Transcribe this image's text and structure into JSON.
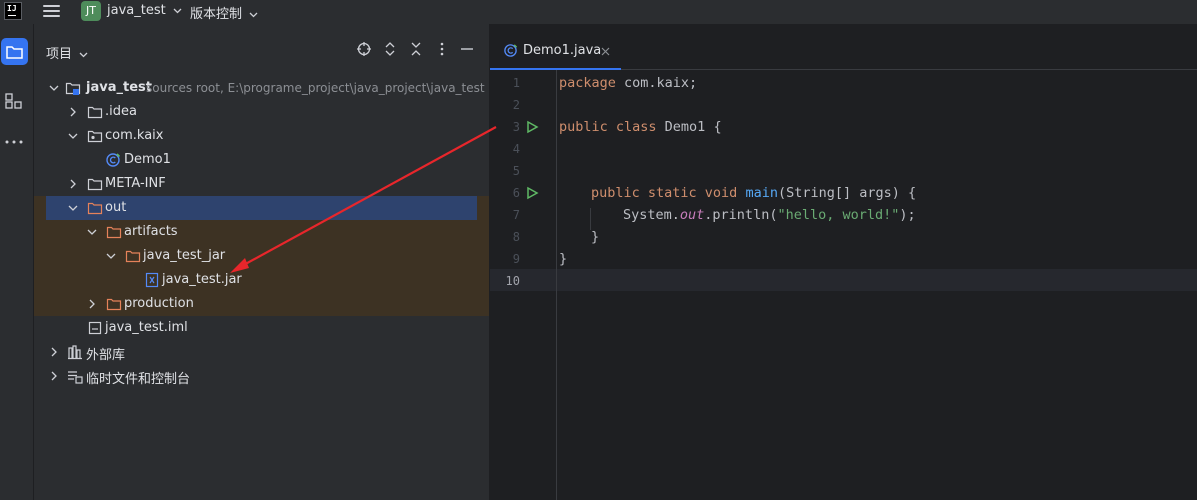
{
  "titlebar": {
    "logo_text": "IJ",
    "project_badge": "JT",
    "project_name": "java_test",
    "vcs_label": "版本控制"
  },
  "toolstrip": {
    "icons": [
      "folder-icon",
      "structure-icon",
      "more-icon"
    ]
  },
  "project_panel": {
    "title": "项目",
    "tree": [
      {
        "label": "java_test",
        "sub": "sources root,  E:\\programe_project\\java_project\\java_test",
        "icon": "module-folder-icon",
        "expanded": true
      },
      {
        "label": ".idea",
        "icon": "folder-icon",
        "expanded": false
      },
      {
        "label": "com.kaix",
        "icon": "package-icon",
        "expanded": true
      },
      {
        "label": "Demo1",
        "icon": "java-class-icon"
      },
      {
        "label": "META-INF",
        "icon": "folder-icon",
        "expanded": false
      },
      {
        "label": "out",
        "icon": "excluded-folder-icon",
        "expanded": true,
        "selected": true
      },
      {
        "label": "artifacts",
        "icon": "excluded-folder-icon",
        "expanded": true
      },
      {
        "label": "java_test_jar",
        "icon": "excluded-folder-icon",
        "expanded": true
      },
      {
        "label": "java_test.jar",
        "icon": "jar-icon"
      },
      {
        "label": "production",
        "icon": "excluded-folder-icon",
        "expanded": false
      },
      {
        "label": "java_test.iml",
        "icon": "iml-file-icon"
      },
      {
        "label": "外部库",
        "icon": "library-icon",
        "expanded": false
      },
      {
        "label": "临时文件和控制台",
        "icon": "scratches-icon",
        "expanded": false
      }
    ]
  },
  "editor": {
    "tab_label": "Demo1.java",
    "current_line": 10,
    "line_numbers": [
      "1",
      "2",
      "3",
      "4",
      "5",
      "6",
      "7",
      "8",
      "9",
      "10"
    ],
    "lines": {
      "l1": {
        "kw": "package",
        "rest": " com.kaix;"
      },
      "l3": {
        "kw": "public class",
        "rest": " Demo1 {"
      },
      "l6": {
        "kw": "public static void",
        "fn": "main",
        "rest": "(String[] args) {"
      },
      "l7": {
        "pre": "System.",
        "it": "out",
        "mid": ".println(",
        "str": "\"hello, world!\"",
        "end": ");"
      },
      "l8": {
        "text": "}"
      },
      "l9": {
        "text": "}"
      }
    }
  },
  "colors": {
    "accent": "#3574f0",
    "excluded_bg": "#3d3223",
    "selection_bg": "#2e436e",
    "annotation_arrow": "#e8262b"
  }
}
